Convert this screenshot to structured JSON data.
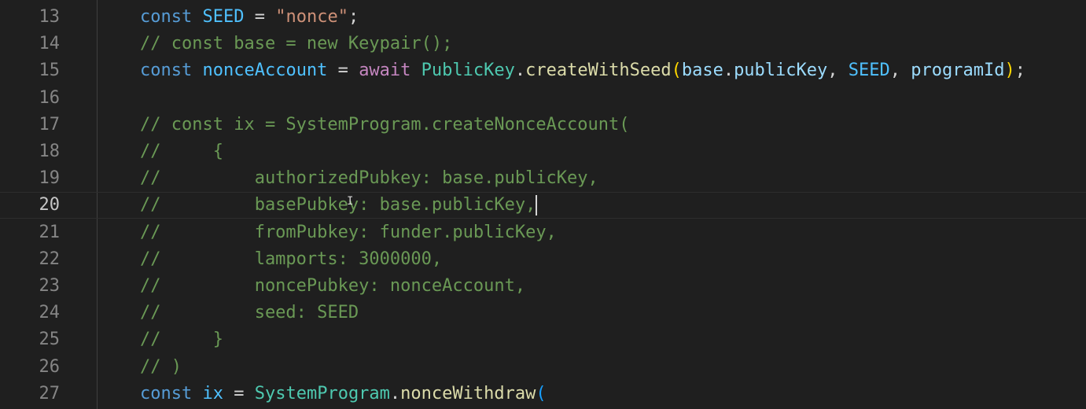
{
  "editor": {
    "current_line": 20,
    "lines": [
      {
        "num": "13",
        "tokens": [
          {
            "t": "const ",
            "c": "kw"
          },
          {
            "t": "SEED",
            "c": "const-var"
          },
          {
            "t": " = ",
            "c": "plain"
          },
          {
            "t": "\"nonce\"",
            "c": "str"
          },
          {
            "t": ";",
            "c": "plain"
          }
        ]
      },
      {
        "num": "14",
        "tokens": [
          {
            "t": "// const base = new Keypair();",
            "c": "cmt"
          }
        ]
      },
      {
        "num": "15",
        "tokens": [
          {
            "t": "const ",
            "c": "kw"
          },
          {
            "t": "nonceAccount",
            "c": "const-var"
          },
          {
            "t": " = ",
            "c": "plain"
          },
          {
            "t": "await ",
            "c": "await"
          },
          {
            "t": "PublicKey",
            "c": "cls"
          },
          {
            "t": ".",
            "c": "plain"
          },
          {
            "t": "createWithSeed",
            "c": "fn"
          },
          {
            "t": "(",
            "c": "paren-y"
          },
          {
            "t": "base",
            "c": "var"
          },
          {
            "t": ".",
            "c": "plain"
          },
          {
            "t": "publicKey",
            "c": "var"
          },
          {
            "t": ", ",
            "c": "plain"
          },
          {
            "t": "SEED",
            "c": "const-var"
          },
          {
            "t": ", ",
            "c": "plain"
          },
          {
            "t": "programId",
            "c": "var"
          },
          {
            "t": ")",
            "c": "paren-y"
          },
          {
            "t": ";",
            "c": "plain"
          }
        ]
      },
      {
        "num": "16",
        "tokens": []
      },
      {
        "num": "17",
        "tokens": [
          {
            "t": "// const ix = SystemProgram.createNonceAccount(",
            "c": "cmt"
          }
        ]
      },
      {
        "num": "18",
        "tokens": [
          {
            "t": "//     {",
            "c": "cmt"
          }
        ]
      },
      {
        "num": "19",
        "tokens": [
          {
            "t": "//         authorizedPubkey: base.publicKey,",
            "c": "cmt"
          }
        ]
      },
      {
        "num": "20",
        "tokens": [
          {
            "t": "//         basePubkey: base.publicKey,",
            "c": "cmt"
          }
        ]
      },
      {
        "num": "21",
        "tokens": [
          {
            "t": "//         fromPubkey: funder.publicKey,",
            "c": "cmt"
          }
        ]
      },
      {
        "num": "22",
        "tokens": [
          {
            "t": "//         lamports: 3000000,",
            "c": "cmt"
          }
        ]
      },
      {
        "num": "23",
        "tokens": [
          {
            "t": "//         noncePubkey: nonceAccount,",
            "c": "cmt"
          }
        ]
      },
      {
        "num": "24",
        "tokens": [
          {
            "t": "//         seed: SEED",
            "c": "cmt"
          }
        ]
      },
      {
        "num": "25",
        "tokens": [
          {
            "t": "//     }",
            "c": "cmt"
          }
        ]
      },
      {
        "num": "26",
        "tokens": [
          {
            "t": "// )",
            "c": "cmt"
          }
        ]
      },
      {
        "num": "27",
        "tokens": [
          {
            "t": "const ",
            "c": "kw"
          },
          {
            "t": "ix",
            "c": "const-var"
          },
          {
            "t": " = ",
            "c": "plain"
          },
          {
            "t": "SystemProgram",
            "c": "cls"
          },
          {
            "t": ".",
            "c": "plain"
          },
          {
            "t": "nonceWithdraw",
            "c": "fn"
          },
          {
            "t": "(",
            "c": "paren"
          }
        ]
      }
    ]
  }
}
